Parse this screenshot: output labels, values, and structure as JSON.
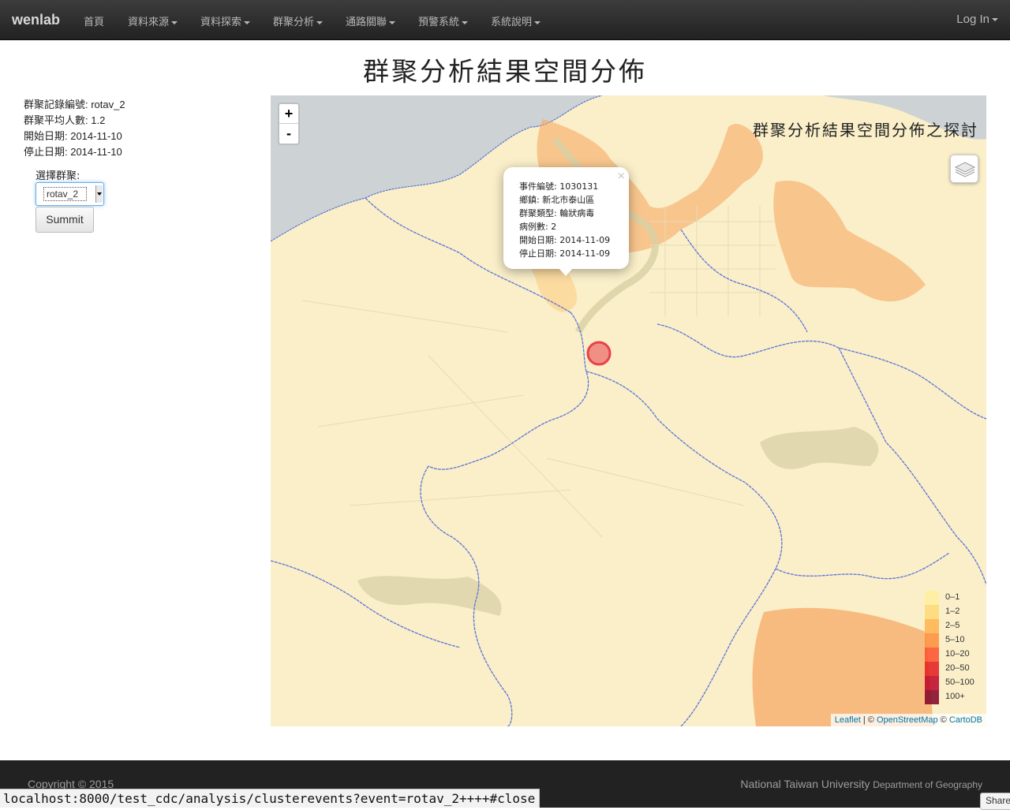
{
  "navbar": {
    "brand": "wenlab",
    "items": [
      {
        "label": "首頁",
        "dropdown": false
      },
      {
        "label": "資料來源",
        "dropdown": true
      },
      {
        "label": "資料探索",
        "dropdown": true
      },
      {
        "label": "群聚分析",
        "dropdown": true
      },
      {
        "label": "通路關聯",
        "dropdown": true
      },
      {
        "label": "預警系統",
        "dropdown": true
      },
      {
        "label": "系統說明",
        "dropdown": true
      }
    ],
    "login": "Log In",
    "login_dropdown": true
  },
  "page_title": "群聚分析結果空間分佈",
  "info": {
    "record_id": "群聚記錄編號: rotav_2",
    "avg_people": "群聚平均人數: 1.2",
    "start_date": "開始日期: 2014-11-10",
    "end_date": "停止日期: 2014-11-10"
  },
  "form": {
    "select_label": "選擇群聚:",
    "select_value": "rotav_2",
    "submit_label": "Summit"
  },
  "map": {
    "zoom_in": "+",
    "zoom_out": "-",
    "overlay_title": "群聚分析結果空間分佈之探討",
    "popup": {
      "close": "×",
      "lines": [
        "事件編號: 1030131",
        "鄉鎮: 新北市泰山區",
        "群聚類型: 輪狀病毒",
        "病例數: 2",
        "開始日期: 2014-11-09",
        "停止日期: 2014-11-09"
      ]
    },
    "legend": [
      {
        "label": "0–1",
        "color": "#ffeda0"
      },
      {
        "label": "1–2",
        "color": "#fed976"
      },
      {
        "label": "2–5",
        "color": "#feb24c"
      },
      {
        "label": "5–10",
        "color": "#fd8d3c"
      },
      {
        "label": "10–20",
        "color": "#fc4e2a"
      },
      {
        "label": "20–50",
        "color": "#e31a1c"
      },
      {
        "label": "50–100",
        "color": "#bd0026"
      },
      {
        "label": "100+",
        "color": "#800026"
      }
    ],
    "attribution": {
      "leaflet": "Leaflet",
      "sep1": " | © ",
      "osm": "OpenStreetMap",
      "sep2": " © ",
      "carto": "CartoDB"
    },
    "colors": {
      "land": "#faefc9",
      "water": "#cdd2d4",
      "boundary": "#5b74d6",
      "region_fill": "#f7a966",
      "marker": "#e8414b"
    }
  },
  "footer": {
    "copyright": "Copyright © 2015",
    "university": "National Taiwan University",
    "department": "Department of Geography"
  },
  "status_url": "localhost:8000/test_cdc/analysis/clusterevents?event=rotav_2++++#close",
  "share_label": "Share"
}
